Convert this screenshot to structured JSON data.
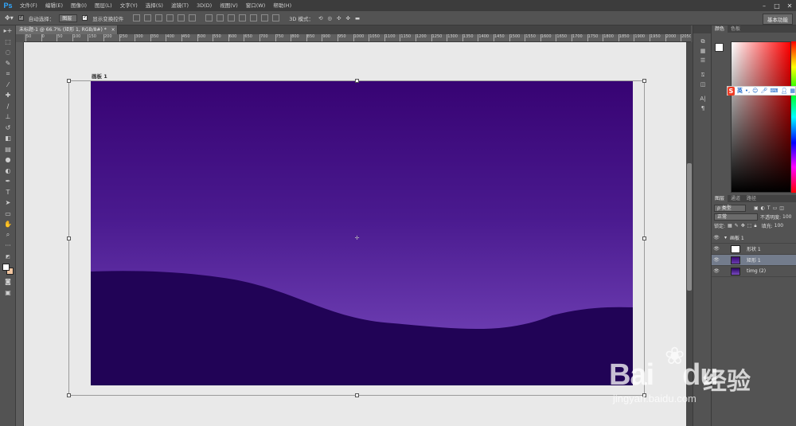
{
  "app": {
    "logo": "Ps"
  },
  "menu": [
    "文件(F)",
    "编辑(E)",
    "图像(I)",
    "图层(L)",
    "文字(Y)",
    "选择(S)",
    "滤镜(T)",
    "3D(D)",
    "视图(V)",
    "窗口(W)",
    "帮助(H)"
  ],
  "options": {
    "auto_select_label": "自动选择：",
    "auto_select_value": "图层",
    "show_transform_label": "显示变换控件",
    "mode_3d_label": "3D 模式：",
    "workspace": "基本功能"
  },
  "document": {
    "tab_title": "未标题-1 @ 66.7% (矩形 1, RGB/8#) *",
    "artboard_name": "画板 1"
  },
  "ruler_ticks": [
    "50",
    "0",
    "50",
    "100",
    "150",
    "200",
    "250",
    "300",
    "350",
    "400",
    "450",
    "500",
    "550",
    "600",
    "650",
    "700",
    "750",
    "800",
    "850",
    "900",
    "950",
    "1000",
    "1050",
    "1100",
    "1150",
    "1200",
    "1250",
    "1300",
    "1350",
    "1400",
    "1450",
    "1500",
    "1550",
    "1600",
    "1650",
    "1700",
    "1750",
    "1800",
    "1850",
    "1900",
    "1950",
    "2000",
    "2050"
  ],
  "color_panel": {
    "tabs": [
      "颜色",
      "色板"
    ],
    "foreground": "#ffffff",
    "background": "#f1c5a0"
  },
  "ime_bar": {
    "logo": "S",
    "mode": "英"
  },
  "layers_panel": {
    "tabs": [
      "图层",
      "通道",
      "路径"
    ],
    "filter_label": "ρ 类型",
    "blend_mode": "正常",
    "opacity_label": "不透明度:",
    "opacity_value": "100",
    "lock_label": "锁定:",
    "fill_label": "填充:",
    "fill_value": "100",
    "layers": [
      {
        "name": "画板 1",
        "type": "group"
      },
      {
        "name": "形状 1",
        "type": "shape"
      },
      {
        "name": "矩形 1",
        "type": "shape",
        "selected": true
      },
      {
        "name": "timg (2)",
        "type": "image"
      }
    ]
  },
  "watermark": {
    "logo": "Bai",
    "logo_suffix": "du",
    "brand_cn": "经验",
    "url": "jingyan.baidu.com"
  },
  "colors": {
    "accent": "#31a8ff",
    "artboard_top": "#370373",
    "artboard_bottom": "#7a4bbf",
    "wave": "#210356"
  }
}
